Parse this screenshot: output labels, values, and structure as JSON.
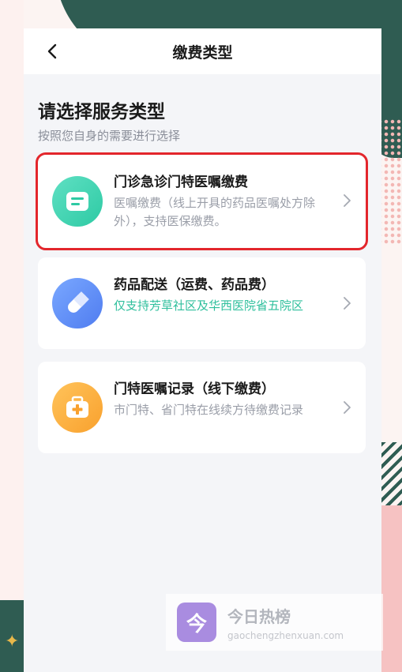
{
  "navbar": {
    "title": "缴费类型"
  },
  "heading": {
    "title": "请选择服务类型",
    "subtitle": "按照您自身的需要进行选择"
  },
  "cards": [
    {
      "title": "门诊急诊门特医嘱缴费",
      "desc": "医嘱缴费（线上开具的药品医嘱处方除外），支持医保缴费。",
      "icon": "prescription-icon",
      "highlighted": true
    },
    {
      "title": "药品配送（运费、药品费）",
      "desc": "仅支持芳草社区及华西医院省五院区",
      "icon": "pill-icon",
      "desc_color": "#2ebf9c"
    },
    {
      "title": "门特医嘱记录（线下缴费）",
      "desc": "市门特、省门特在线续方待缴费记录",
      "icon": "medical-kit-icon"
    }
  ],
  "watermark": {
    "logo_char": "今",
    "title": "今日热榜",
    "url": "gaochengzhenxuan.com"
  },
  "colors": {
    "accent_green": "#2ebf9c",
    "highlight_red": "#e3262c",
    "blue": "#4f7cf0",
    "orange": "#f9a12e"
  }
}
